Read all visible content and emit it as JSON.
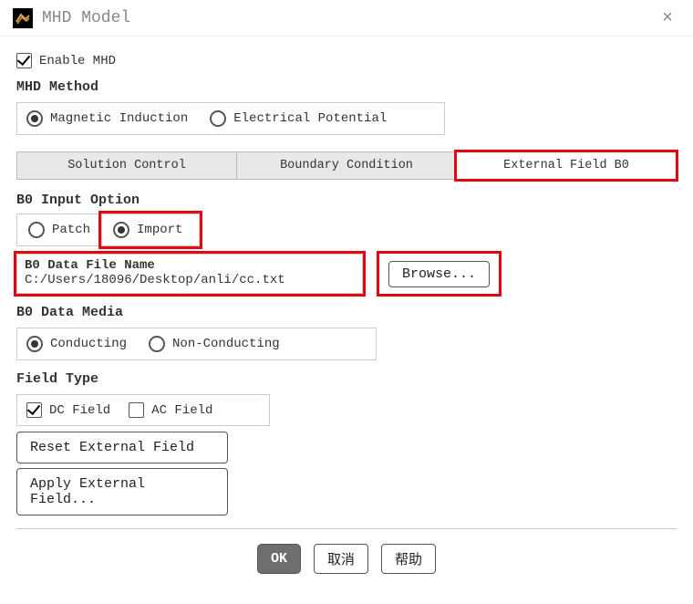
{
  "window": {
    "title": "MHD Model",
    "close_label": "×"
  },
  "enable_mhd": {
    "checked": true,
    "label": "Enable MHD"
  },
  "mhd_method": {
    "title": "MHD Method",
    "options": {
      "magnetic": "Magnetic Induction",
      "electrical": "Electrical Potential"
    },
    "selected": "magnetic"
  },
  "tabs": {
    "solution": "Solution Control",
    "boundary": "Boundary Condition",
    "external": "External Field B0",
    "active": "external"
  },
  "b0_input": {
    "title": "B0 Input Option",
    "patch": "Patch",
    "import": "Import",
    "selected": "import"
  },
  "b0_file": {
    "label": "B0 Data File Name",
    "value": "C:/Users/18096/Desktop/anli/cc.txt",
    "browse": "Browse..."
  },
  "b0_media": {
    "title": "B0 Data Media",
    "conducting": "Conducting",
    "nonconducting": "Non-Conducting",
    "selected": "conducting"
  },
  "field_type": {
    "title": "Field Type",
    "dc": {
      "label": "DC Field",
      "checked": true
    },
    "ac": {
      "label": "AC Field",
      "checked": false
    }
  },
  "buttons": {
    "reset": "Reset External Field",
    "apply": "Apply External Field...",
    "ok": "OK",
    "cancel": "取消",
    "help": "帮助"
  }
}
